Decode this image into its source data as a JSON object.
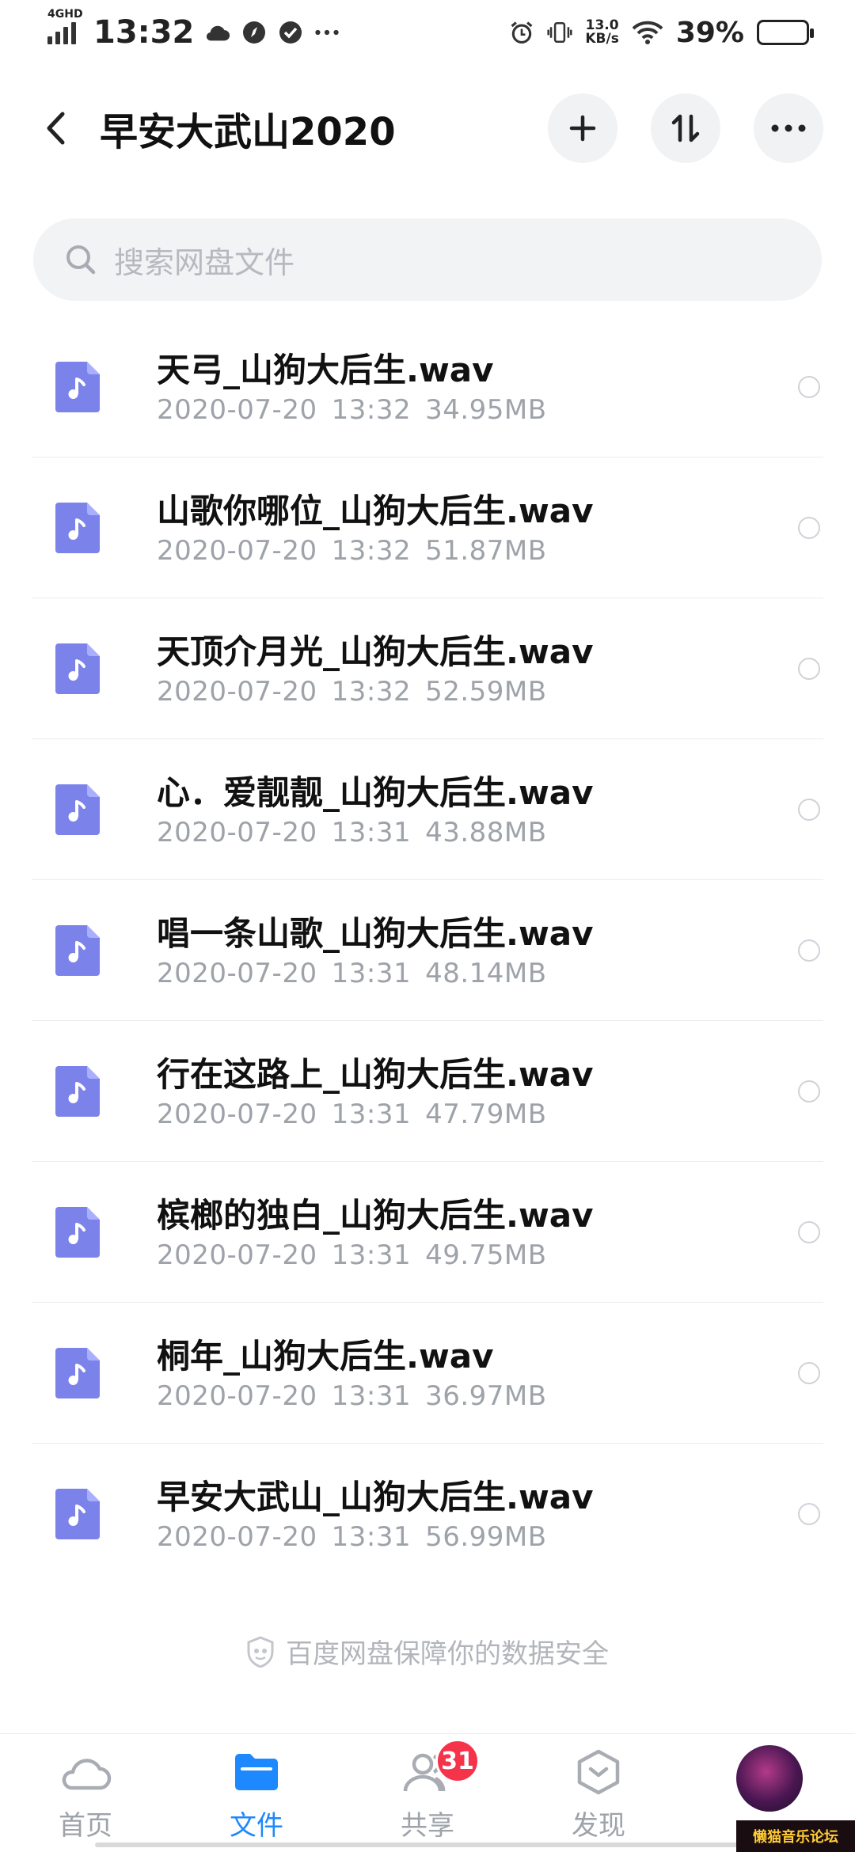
{
  "status_bar": {
    "network": "4GHD",
    "time": "13:32",
    "net_speed_value": "13.0",
    "net_speed_unit": "KB/s",
    "battery_percent": "39%",
    "battery_level": 0.39
  },
  "header": {
    "title": "早安大武山2020",
    "icons": [
      "back-icon",
      "add-icon",
      "sort-icon",
      "more-icon"
    ]
  },
  "search": {
    "placeholder": "搜索网盘文件"
  },
  "files": [
    {
      "name": "天弓_山狗大后生.wav",
      "date": "2020-07-20",
      "time": "13:32",
      "size": "34.95MB"
    },
    {
      "name": "山歌你哪位_山狗大后生.wav",
      "date": "2020-07-20",
      "time": "13:32",
      "size": "51.87MB"
    },
    {
      "name": "天顶介月光_山狗大后生.wav",
      "date": "2020-07-20",
      "time": "13:32",
      "size": "52.59MB"
    },
    {
      "name": "心．爱靓靓_山狗大后生.wav",
      "date": "2020-07-20",
      "time": "13:31",
      "size": "43.88MB"
    },
    {
      "name": "唱一条山歌_山狗大后生.wav",
      "date": "2020-07-20",
      "time": "13:31",
      "size": "48.14MB"
    },
    {
      "name": "行在这路上_山狗大后生.wav",
      "date": "2020-07-20",
      "time": "13:31",
      "size": "47.79MB"
    },
    {
      "name": "槟榔的独白_山狗大后生.wav",
      "date": "2020-07-20",
      "time": "13:31",
      "size": "49.75MB"
    },
    {
      "name": "桐年_山狗大后生.wav",
      "date": "2020-07-20",
      "time": "13:31",
      "size": "36.97MB"
    },
    {
      "name": "早安大武山_山狗大后生.wav",
      "date": "2020-07-20",
      "time": "13:31",
      "size": "56.99MB"
    }
  ],
  "safety_note": "百度网盘保障你的数据安全",
  "tabs": [
    {
      "label": "首页",
      "icon": "cloud-icon",
      "active": false
    },
    {
      "label": "文件",
      "icon": "folder-icon",
      "active": true
    },
    {
      "label": "共享",
      "icon": "people-icon",
      "active": false,
      "badge": "31"
    },
    {
      "label": "发现",
      "icon": "discover-icon",
      "active": false
    },
    {
      "label": "",
      "icon": "avatar",
      "active": false
    }
  ],
  "watermark": "懒猫音乐论坛",
  "colors": {
    "accent": "#1e88ff",
    "file_icon": "#7b83eb",
    "badge": "#f5334a",
    "muted_text": "#9ea2a9"
  }
}
